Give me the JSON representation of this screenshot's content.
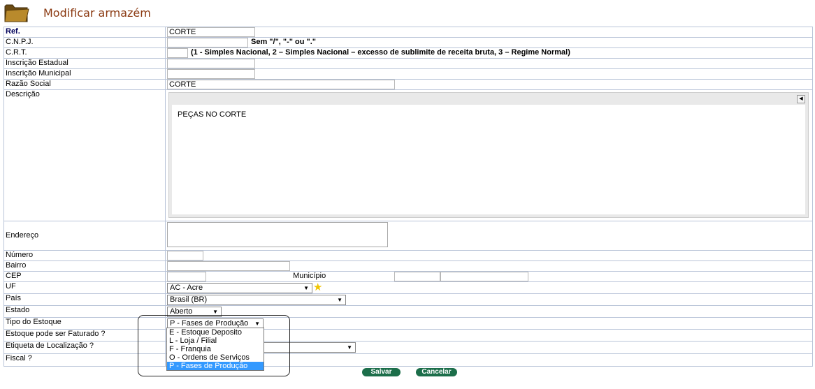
{
  "page": {
    "title": "Modificar armazém"
  },
  "fields": {
    "ref": {
      "label": "Ref.",
      "value": "CORTE"
    },
    "cnpj": {
      "label": "C.N.P.J.",
      "value": "",
      "hint": "Sem \"/\", \"-\" ou \".\""
    },
    "crt": {
      "label": "C.R.T.",
      "value": "",
      "hint": "(1 - Simples Nacional, 2 – Simples Nacional – excesso de sublimite de receita bruta, 3 – Regime Normal)"
    },
    "inscricao_estadual": {
      "label": "Inscrição Estadual",
      "value": ""
    },
    "inscricao_municipal": {
      "label": "Inscrição Municipal",
      "value": ""
    },
    "razao_social": {
      "label": "Razão Social",
      "value": "CORTE"
    },
    "descricao": {
      "label": "Descrição",
      "value": "PEÇAS NO CORTE"
    },
    "endereco": {
      "label": "Endereço",
      "value": ""
    },
    "numero": {
      "label": "Número",
      "value": ""
    },
    "bairro": {
      "label": "Bairro",
      "value": ""
    },
    "cep": {
      "label": "CEP",
      "value": ""
    },
    "municipio": {
      "label": "Município",
      "value": ""
    },
    "uf": {
      "label": "UF",
      "value": "AC - Acre"
    },
    "pais": {
      "label": "País",
      "value": "Brasil (BR)"
    },
    "estado": {
      "label": "Estado",
      "value": "Aberto"
    },
    "tipo_estoque": {
      "label": "Tipo do Estoque",
      "value": "P - Fases de Produção",
      "options": [
        "E - Estoque Deposito",
        "L - Loja / Filial",
        "F - Franquia",
        "O - Ordens de Serviços",
        "P - Fases de Produção"
      ],
      "selected_index": 4
    },
    "estoque_faturado": {
      "label": "Estoque pode ser Faturado ?"
    },
    "etiqueta": {
      "label": "Etiqueta de Localização ?"
    },
    "fiscal": {
      "label": "Fiscal ?"
    }
  },
  "buttons": {
    "save": "Salvar",
    "cancel": "Cancelar"
  },
  "colors": {
    "title": "#8b3a12",
    "button": "#1c6e4a",
    "dropdown_selected": "#3399ff",
    "border": "#b9c4d8"
  },
  "icons": {
    "header": "folder-icon",
    "favorite": "star-icon"
  }
}
